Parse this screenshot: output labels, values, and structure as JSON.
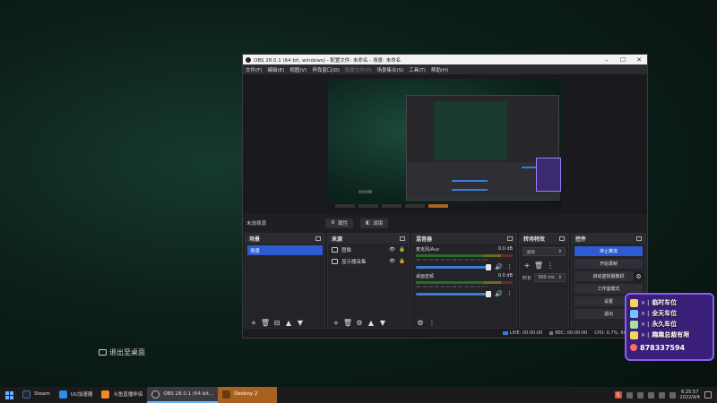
{
  "desktop": {
    "exit_hint": "退出至桌面"
  },
  "obs": {
    "title": "OBS 28.0.1 (64 bit, windows) - 配置文件: 未命名 - 场景: 未命名",
    "menu": [
      "文件(F)",
      "编辑(E)",
      "视图(V)",
      "停靠窗口(D)",
      "配置文件(P)",
      "场景集合(S)",
      "工具(T)",
      "帮助(H)"
    ],
    "preview_caption": "退出至桌面",
    "scene_bar": {
      "label": "未选择源",
      "properties": "属性",
      "filters": "滤镜"
    },
    "scenes": {
      "title": "场景",
      "items": [
        "场景"
      ]
    },
    "sources": {
      "title": "来源",
      "items": [
        {
          "name": "图像"
        },
        {
          "name": "显示器采集"
        }
      ]
    },
    "mixer": {
      "title": "混音器",
      "channels": [
        {
          "name": "麦克风/Aux",
          "db": "0.0 dB"
        },
        {
          "name": "桌面音频",
          "db": "0.0 dB"
        }
      ],
      "ticks": "-60 -55 -50 -45 -40 -35 -30 -25 -20 -15 -10 -5 0"
    },
    "transitions": {
      "title": "转场特效",
      "type": "淡出",
      "duration_label": "时长",
      "duration_value": "300 ms"
    },
    "controls": {
      "title": "控件",
      "buttons": [
        "停止推流",
        "开始录制",
        "启动虚拟摄像机",
        "工作室模式",
        "设置",
        "退出"
      ]
    },
    "status": {
      "live": "LIVE: 00:00:00",
      "rec": "REC: 00:00:00",
      "cpu": "CPU: 0.7%, 60.00 fps"
    }
  },
  "promo": {
    "rows": [
      "临时车位",
      "全天车位",
      "永久车位",
      "趣趣总裁有限"
    ],
    "qq": "878337594"
  },
  "taskbar": {
    "items": [
      {
        "label": "Steam",
        "color": "#1b2838"
      },
      {
        "label": "UU加速器",
        "color": "#2d8cf0"
      },
      {
        "label": "斗鱼直播伴侣",
        "color": "#f08a24"
      },
      {
        "label": "OBS 28.0.1 (64 bit...",
        "color": "#303030"
      },
      {
        "label": "Destiny 2",
        "color": "#a8611e"
      }
    ],
    "ime": "S",
    "time": "6:25:57",
    "date": "2022/9/4"
  },
  "colors": {
    "accent": "#2c5cd0",
    "promo_bg": "#3a1f78",
    "promo_border": "#8b5cf6"
  }
}
